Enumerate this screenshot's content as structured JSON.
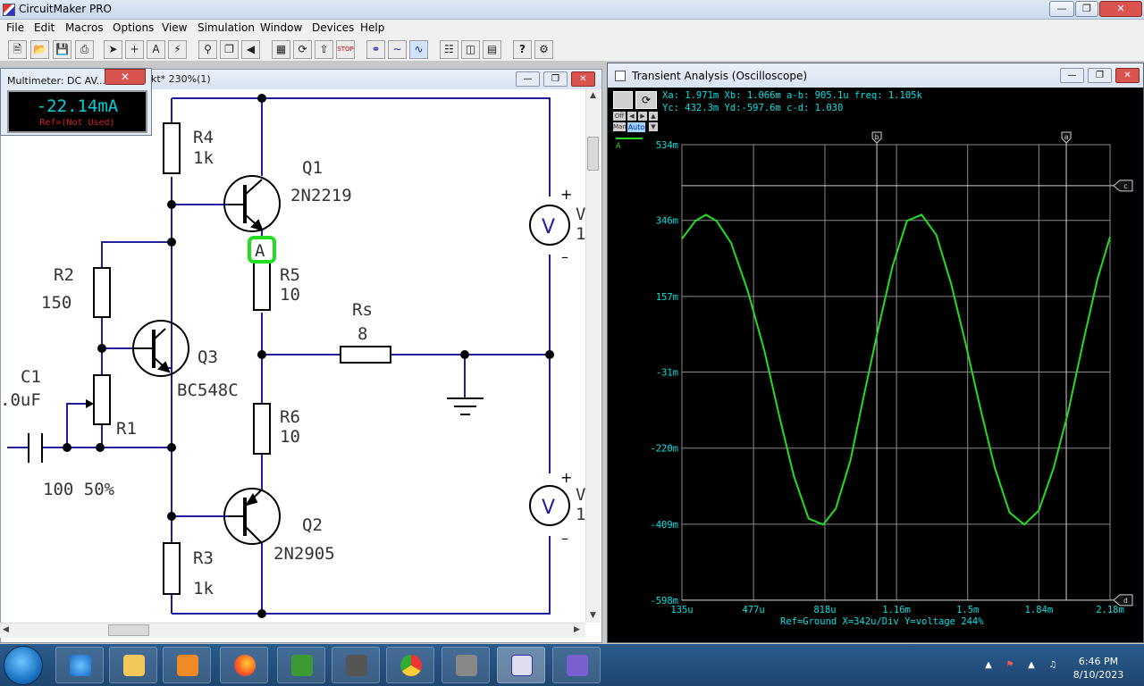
{
  "app": {
    "title": "CircuitMaker PRO"
  },
  "menu": [
    "File",
    "Edit",
    "Macros",
    "Options",
    "View",
    "Simulation",
    "Window",
    "Devices",
    "Help"
  ],
  "schematic_window": {
    "title_suffix": "kt* 230%(1)"
  },
  "multimeter": {
    "title": "Multimeter: DC AV...",
    "value": "-22.14mA",
    "ref": "Ref=(Not Used)"
  },
  "components": {
    "r4": {
      "name": "R4",
      "value": "1k"
    },
    "q1": {
      "name": "Q1",
      "value": "2N2219"
    },
    "r2": {
      "name": "R2",
      "value": "150"
    },
    "r5": {
      "name": "R5",
      "value": "10"
    },
    "rs": {
      "name": "Rs",
      "value": "8"
    },
    "q3": {
      "name": "Q3",
      "value": "BC548C"
    },
    "c1": {
      "name": "C1",
      "value": ".0uF"
    },
    "r1": {
      "name": "R1",
      "value": "100 50%"
    },
    "r6": {
      "name": "R6",
      "value": "10"
    },
    "q2": {
      "name": "Q2",
      "value": "2N2905"
    },
    "r3": {
      "name": "R3",
      "value": "1k"
    },
    "probe": "A",
    "v_label": "V",
    "v_top_value": "1",
    "v_bot_value": "1"
  },
  "oscilloscope": {
    "title": "Transient Analysis (Oscilloscope)",
    "cursor_line1": "Xa: 1.971m  Xb: 1.066m  a-b: 905.1u  freq: 1.105k",
    "cursor_line2": "Yc: 432.3m  Yd:-597.6m  c-d: 1.030",
    "off_label": "Off",
    "man_label": "Man",
    "auto_label": "Auto",
    "channel_label": "A",
    "footer": "Ref=Ground  X=342u/Div Y=voltage 244%",
    "markers": {
      "a": "a",
      "b": "b",
      "c": "c",
      "d": "d"
    }
  },
  "chart_data": {
    "type": "line",
    "title": "",
    "xlabel": "",
    "ylabel": "",
    "x_tick_labels": [
      "135u",
      "477u",
      "818u",
      "1.16m",
      "1.5m",
      "1.84m",
      "2.18m"
    ],
    "y_tick_labels": [
      "534m",
      "346m",
      "157m",
      "-31m",
      "-220m",
      "-409m",
      "-598m"
    ],
    "x_ticks": [
      0.135,
      0.477,
      0.818,
      1.16,
      1.5,
      1.84,
      2.18
    ],
    "y_ticks": [
      534,
      346,
      157,
      -31,
      -220,
      -409,
      -598
    ],
    "xlim": [
      0.135,
      2.18
    ],
    "ylim": [
      -598,
      534
    ],
    "x_unit": "ms",
    "y_unit": "mV",
    "grid": true,
    "series": [
      {
        "color": "#22dd22",
        "x": [
          0.135,
          0.2,
          0.25,
          0.3,
          0.37,
          0.45,
          0.53,
          0.6,
          0.67,
          0.74,
          0.81,
          0.87,
          0.94,
          1.0,
          1.07,
          1.14,
          1.21,
          1.28,
          1.35,
          1.42,
          1.49,
          1.56,
          1.63,
          1.7,
          1.77,
          1.84,
          1.91,
          1.98,
          2.05,
          2.12,
          2.18
        ],
        "values": [
          300,
          345,
          360,
          345,
          290,
          170,
          20,
          -140,
          -290,
          -395,
          -410,
          -370,
          -250,
          -100,
          70,
          230,
          345,
          360,
          310,
          190,
          40,
          -120,
          -270,
          -380,
          -410,
          -375,
          -270,
          -130,
          40,
          200,
          305
        ]
      }
    ],
    "cursors": {
      "xa": 1.971,
      "xb": 1.066,
      "yc": 432.3,
      "yd": -597.6
    }
  },
  "taskbar": {
    "time": "6:46 PM",
    "date": "8/10/2023"
  }
}
